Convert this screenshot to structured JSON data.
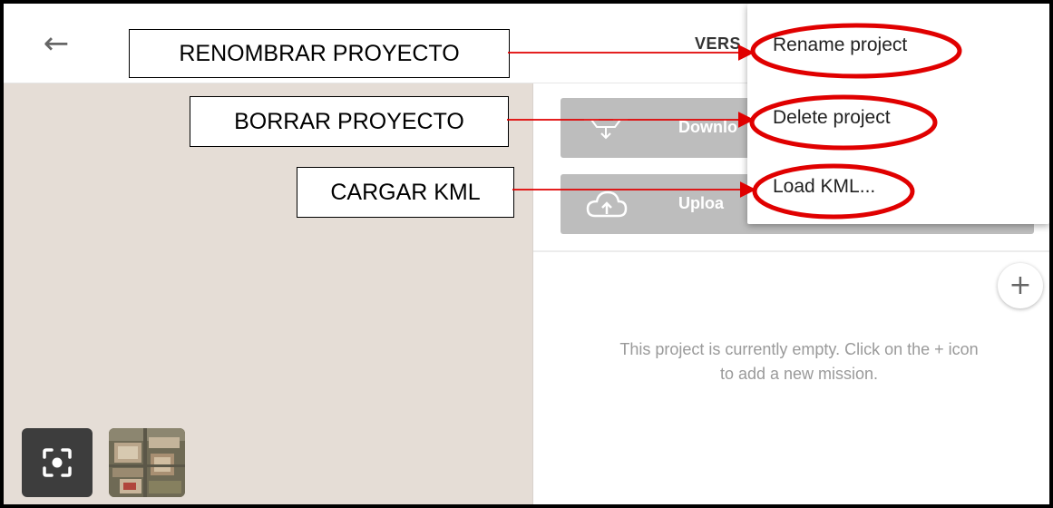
{
  "topbar": {
    "back_icon": "arrow-left-icon",
    "version_text": "VERS"
  },
  "panel": {
    "download_label": "Downlo",
    "download_icon": "drone-download-icon",
    "upload_label": "Uploa",
    "upload_icon": "cloud-upload-icon",
    "add_icon": "plus-icon",
    "add_symbol": "+",
    "empty_line1": "This project is currently empty. Click on the + icon",
    "empty_line2": "to add a new mission."
  },
  "menu": {
    "items": [
      {
        "label": "Rename project"
      },
      {
        "label": "Delete project"
      },
      {
        "label": "Load KML..."
      }
    ]
  },
  "annotations": [
    {
      "text": "RENOMBRAR PROYECTO"
    },
    {
      "text": "BORRAR PROYECTO"
    },
    {
      "text": "CARGAR KML"
    }
  ],
  "map": {
    "recenter_icon": "focus-target-icon",
    "layer_thumb": "satellite-layer-thumbnail"
  },
  "colors": {
    "annotation_red": "#e00000",
    "button_gray": "#bdbdbd",
    "map_bg": "#e5ddd6"
  }
}
